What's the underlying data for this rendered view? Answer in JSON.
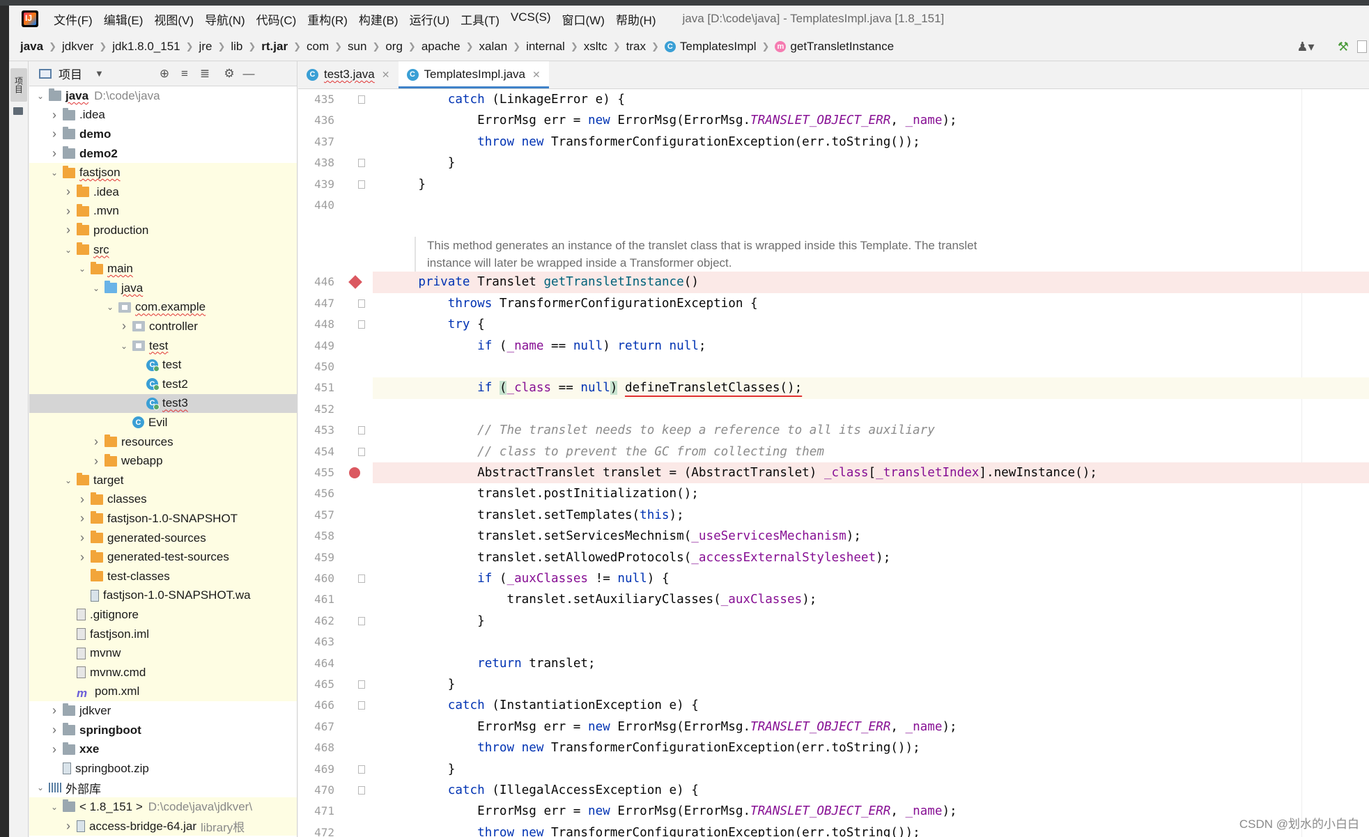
{
  "menu": {
    "items": [
      "文件(F)",
      "编辑(E)",
      "视图(V)",
      "导航(N)",
      "代码(C)",
      "重构(R)",
      "构建(B)",
      "运行(U)",
      "工具(T)",
      "VCS(S)",
      "窗口(W)",
      "帮助(H)"
    ],
    "window_title": "java [D:\\code\\java] - TemplatesImpl.java [1.8_151]"
  },
  "breadcrumbs": [
    {
      "label": "java",
      "bold": true
    },
    {
      "label": "jdkver"
    },
    {
      "label": "jdk1.8.0_151"
    },
    {
      "label": "jre"
    },
    {
      "label": "lib"
    },
    {
      "label": "rt.jar",
      "bold": true
    },
    {
      "label": "com"
    },
    {
      "label": "sun"
    },
    {
      "label": "org"
    },
    {
      "label": "apache"
    },
    {
      "label": "xalan"
    },
    {
      "label": "internal"
    },
    {
      "label": "xsltc"
    },
    {
      "label": "trax"
    },
    {
      "label": "TemplatesImpl",
      "icon": "class-icon"
    },
    {
      "label": "getTransletInstance",
      "icon": "method-icon",
      "last": true
    }
  ],
  "tool_stripe": {
    "project_label": "项目"
  },
  "project_panel": {
    "title": "项目",
    "tree": [
      {
        "depth": 0,
        "arrow": "down",
        "icon": "folder-gray",
        "label": "java",
        "bold": true,
        "wavy": true,
        "path": "D:\\code\\java"
      },
      {
        "depth": 1,
        "arrow": "right",
        "icon": "folder-gray",
        "label": ".idea"
      },
      {
        "depth": 1,
        "arrow": "right",
        "icon": "folder-gray",
        "label": "demo",
        "bold": true
      },
      {
        "depth": 1,
        "arrow": "right",
        "icon": "folder-gray",
        "label": "demo2",
        "bold": true
      },
      {
        "depth": 1,
        "arrow": "down",
        "icon": "folder-orange",
        "label": "fastjson",
        "wavy": true,
        "yellow": true
      },
      {
        "depth": 2,
        "arrow": "right",
        "icon": "folder-orange",
        "label": ".idea",
        "yellow": true
      },
      {
        "depth": 2,
        "arrow": "right",
        "icon": "folder-orange",
        "label": ".mvn",
        "yellow": true
      },
      {
        "depth": 2,
        "arrow": "right",
        "icon": "folder-orange",
        "label": "production",
        "yellow": true
      },
      {
        "depth": 2,
        "arrow": "down",
        "icon": "folder-orange",
        "label": "src",
        "wavy": true,
        "yellow": true
      },
      {
        "depth": 3,
        "arrow": "down",
        "icon": "folder-orange",
        "label": "main",
        "wavy": true,
        "yellow": true
      },
      {
        "depth": 4,
        "arrow": "down",
        "icon": "folder-blue",
        "label": "java",
        "wavy": true,
        "yellow": true
      },
      {
        "depth": 5,
        "arrow": "down",
        "icon": "folder-pkg",
        "label": "com.example",
        "wavy": true,
        "yellow": true
      },
      {
        "depth": 6,
        "arrow": "right",
        "icon": "folder-pkg",
        "label": "controller",
        "yellow": true
      },
      {
        "depth": 6,
        "arrow": "down",
        "icon": "folder-pkg",
        "label": "test",
        "wavy": true,
        "yellow": true
      },
      {
        "depth": 7,
        "arrow": "none",
        "icon": "class-test",
        "label": "test",
        "yellow": true
      },
      {
        "depth": 7,
        "arrow": "none",
        "icon": "class-test",
        "label": "test2",
        "yellow": true
      },
      {
        "depth": 7,
        "arrow": "none",
        "icon": "class-test",
        "label": "test3",
        "wavy": true,
        "selected": true
      },
      {
        "depth": 6,
        "arrow": "none",
        "icon": "class",
        "label": "Evil",
        "yellow": true
      },
      {
        "depth": 4,
        "arrow": "right",
        "icon": "folder-orange",
        "label": "resources",
        "yellow": true
      },
      {
        "depth": 4,
        "arrow": "right",
        "icon": "folder-orange",
        "label": "webapp",
        "yellow": true
      },
      {
        "depth": 2,
        "arrow": "down",
        "icon": "folder-orange",
        "label": "target",
        "yellow": true
      },
      {
        "depth": 3,
        "arrow": "right",
        "icon": "folder-orange",
        "label": "classes",
        "yellow": true
      },
      {
        "depth": 3,
        "arrow": "right",
        "icon": "folder-orange",
        "label": "fastjson-1.0-SNAPSHOT",
        "yellow": true
      },
      {
        "depth": 3,
        "arrow": "right",
        "icon": "folder-orange",
        "label": "generated-sources",
        "yellow": true
      },
      {
        "depth": 3,
        "arrow": "right",
        "icon": "folder-orange",
        "label": "generated-test-sources",
        "yellow": true
      },
      {
        "depth": 3,
        "arrow": "none",
        "icon": "folder-orange",
        "label": "test-classes",
        "yellow": true
      },
      {
        "depth": 3,
        "arrow": "none",
        "icon": "jar",
        "label": "fastjson-1.0-SNAPSHOT.wa",
        "yellow": true
      },
      {
        "depth": 2,
        "arrow": "none",
        "icon": "file",
        "label": ".gitignore",
        "yellow": true
      },
      {
        "depth": 2,
        "arrow": "none",
        "icon": "file",
        "label": "fastjson.iml",
        "yellow": true
      },
      {
        "depth": 2,
        "arrow": "none",
        "icon": "file",
        "label": "mvnw",
        "yellow": true
      },
      {
        "depth": 2,
        "arrow": "none",
        "icon": "file",
        "label": "mvnw.cmd",
        "yellow": true
      },
      {
        "depth": 2,
        "arrow": "none",
        "icon": "maven",
        "label": "pom.xml",
        "yellow": true
      },
      {
        "depth": 1,
        "arrow": "right",
        "icon": "folder-gray",
        "label": "jdkver"
      },
      {
        "depth": 1,
        "arrow": "right",
        "icon": "folder-gray",
        "label": "springboot",
        "bold": true
      },
      {
        "depth": 1,
        "arrow": "right",
        "icon": "folder-gray",
        "label": "xxe",
        "bold": true
      },
      {
        "depth": 1,
        "arrow": "none",
        "icon": "jar",
        "label": "springboot.zip"
      },
      {
        "depth": 0,
        "arrow": "down",
        "icon": "lib",
        "label": "外部库"
      },
      {
        "depth": 1,
        "arrow": "down",
        "icon": "folder-gray",
        "label": "< 1.8_151 >",
        "path": "D:\\code\\java\\jdkver\\",
        "yellow": true
      },
      {
        "depth": 2,
        "arrow": "right",
        "icon": "jar",
        "label": "access-bridge-64.jar",
        "suffix": "library根",
        "yellow": true
      }
    ]
  },
  "tabs": [
    {
      "label": "test3.java",
      "active": false,
      "wavy": true
    },
    {
      "label": "TemplatesImpl.java",
      "active": true
    }
  ],
  "javadoc": "This method generates an instance of the translet class that is wrapped inside this Template. The translet instance will later be wrapped inside a Transformer object.",
  "code_lines": [
    {
      "num": "435",
      "tokens": [
        [
          "        ",
          ""
        ],
        [
          "catch",
          "kw"
        ],
        [
          " (LinkageError e) {",
          ""
        ]
      ],
      "fold": true
    },
    {
      "num": "436",
      "tokens": [
        [
          "            ErrorMsg err = ",
          ""
        ],
        [
          "new",
          "kw"
        ],
        [
          " ErrorMsg(ErrorMsg.",
          ""
        ],
        [
          "TRANSLET_OBJECT_ERR",
          "cst"
        ],
        [
          ", ",
          ""
        ],
        [
          "_name",
          "fld"
        ],
        [
          ");",
          ""
        ]
      ]
    },
    {
      "num": "437",
      "tokens": [
        [
          "            ",
          ""
        ],
        [
          "throw",
          "kw"
        ],
        [
          " ",
          ""
        ],
        [
          "new",
          "kw"
        ],
        [
          " TransformerConfigurationException(err.toString());",
          ""
        ]
      ]
    },
    {
      "num": "438",
      "tokens": [
        [
          "        }",
          ""
        ]
      ],
      "fold": true
    },
    {
      "num": "439",
      "tokens": [
        [
          "    }",
          ""
        ]
      ],
      "fold": true
    },
    {
      "num": "440",
      "tokens": [
        [
          "",
          ""
        ]
      ]
    },
    {
      "num": "446",
      "tokens": [
        [
          "    ",
          ""
        ],
        [
          "private",
          "kw"
        ],
        [
          " Translet ",
          ""
        ],
        [
          "getTransletInstance",
          "mth"
        ],
        [
          "()",
          ""
        ]
      ],
      "marker": "diamond",
      "hl": "bp"
    },
    {
      "num": "447",
      "tokens": [
        [
          "        ",
          ""
        ],
        [
          "throws",
          "kw"
        ],
        [
          " TransformerConfigurationException {",
          ""
        ]
      ],
      "fold": true
    },
    {
      "num": "448",
      "tokens": [
        [
          "        ",
          ""
        ],
        [
          "try",
          "kw"
        ],
        [
          " {",
          ""
        ]
      ],
      "fold": true
    },
    {
      "num": "449",
      "tokens": [
        [
          "            ",
          ""
        ],
        [
          "if",
          "kw"
        ],
        [
          " (",
          ""
        ],
        [
          "_name",
          "fld"
        ],
        [
          " == ",
          ""
        ],
        [
          "null",
          "kw"
        ],
        [
          ") ",
          ""
        ],
        [
          "return",
          "kw"
        ],
        [
          " ",
          ""
        ],
        [
          "null",
          "kw"
        ],
        [
          ";",
          ""
        ]
      ]
    },
    {
      "num": "450",
      "tokens": [
        [
          "",
          ""
        ]
      ]
    },
    {
      "num": "451",
      "tokens": [
        [
          "            ",
          ""
        ],
        [
          "if",
          "kw"
        ],
        [
          " ",
          ""
        ],
        [
          "(",
          "brace"
        ],
        [
          "_class",
          "fld"
        ],
        [
          " == ",
          ""
        ],
        [
          "null",
          "kw"
        ],
        [
          ")",
          "brace"
        ],
        [
          " ",
          ""
        ],
        [
          "defineTransletClasses();",
          "err"
        ]
      ],
      "hl": "caret"
    },
    {
      "num": "452",
      "tokens": [
        [
          "",
          ""
        ]
      ]
    },
    {
      "num": "453",
      "tokens": [
        [
          "            ",
          ""
        ],
        [
          "// The translet needs to keep a reference to all its auxiliary",
          "cm"
        ]
      ],
      "fold": true
    },
    {
      "num": "454",
      "tokens": [
        [
          "            ",
          ""
        ],
        [
          "// class to prevent the GC from collecting them",
          "cm"
        ]
      ],
      "fold": true
    },
    {
      "num": "455",
      "tokens": [
        [
          "            AbstractTranslet translet = (AbstractTranslet) ",
          ""
        ],
        [
          "_class",
          "fld"
        ],
        [
          "[",
          ""
        ],
        [
          "_transletIndex",
          "fld"
        ],
        [
          "].newInstance();",
          ""
        ]
      ],
      "marker": "dot",
      "hl": "bp"
    },
    {
      "num": "456",
      "tokens": [
        [
          "            translet.postInitialization();",
          ""
        ]
      ]
    },
    {
      "num": "457",
      "tokens": [
        [
          "            translet.setTemplates(",
          ""
        ],
        [
          "this",
          "kw"
        ],
        [
          ");",
          ""
        ]
      ]
    },
    {
      "num": "458",
      "tokens": [
        [
          "            translet.setServicesMechnism(",
          ""
        ],
        [
          "_useServicesMechanism",
          "fld"
        ],
        [
          ");",
          ""
        ]
      ]
    },
    {
      "num": "459",
      "tokens": [
        [
          "            translet.setAllowedProtocols(",
          ""
        ],
        [
          "_accessExternalStylesheet",
          "fld"
        ],
        [
          ");",
          ""
        ]
      ]
    },
    {
      "num": "460",
      "tokens": [
        [
          "            ",
          ""
        ],
        [
          "if",
          "kw"
        ],
        [
          " (",
          ""
        ],
        [
          "_auxClasses",
          "fld"
        ],
        [
          " != ",
          ""
        ],
        [
          "null",
          "kw"
        ],
        [
          ") {",
          ""
        ]
      ],
      "fold": true
    },
    {
      "num": "461",
      "tokens": [
        [
          "                translet.setAuxiliaryClasses(",
          ""
        ],
        [
          "_auxClasses",
          "fld"
        ],
        [
          ");",
          ""
        ]
      ]
    },
    {
      "num": "462",
      "tokens": [
        [
          "            }",
          ""
        ]
      ],
      "fold": true
    },
    {
      "num": "463",
      "tokens": [
        [
          "",
          ""
        ]
      ]
    },
    {
      "num": "464",
      "tokens": [
        [
          "            ",
          ""
        ],
        [
          "return",
          "kw"
        ],
        [
          " translet;",
          ""
        ]
      ]
    },
    {
      "num": "465",
      "tokens": [
        [
          "        }",
          ""
        ]
      ],
      "fold": true
    },
    {
      "num": "466",
      "tokens": [
        [
          "        ",
          ""
        ],
        [
          "catch",
          "kw"
        ],
        [
          " (InstantiationException e) {",
          ""
        ]
      ],
      "fold": true
    },
    {
      "num": "467",
      "tokens": [
        [
          "            ErrorMsg err = ",
          ""
        ],
        [
          "new",
          "kw"
        ],
        [
          " ErrorMsg(ErrorMsg.",
          ""
        ],
        [
          "TRANSLET_OBJECT_ERR",
          "cst"
        ],
        [
          ", ",
          ""
        ],
        [
          "_name",
          "fld"
        ],
        [
          ");",
          ""
        ]
      ]
    },
    {
      "num": "468",
      "tokens": [
        [
          "            ",
          ""
        ],
        [
          "throw",
          "kw"
        ],
        [
          " ",
          ""
        ],
        [
          "new",
          "kw"
        ],
        [
          " TransformerConfigurationException(err.toString());",
          ""
        ]
      ]
    },
    {
      "num": "469",
      "tokens": [
        [
          "        }",
          ""
        ]
      ],
      "fold": true
    },
    {
      "num": "470",
      "tokens": [
        [
          "        ",
          ""
        ],
        [
          "catch",
          "kw"
        ],
        [
          " (IllegalAccessException e) {",
          ""
        ]
      ],
      "fold": true
    },
    {
      "num": "471",
      "tokens": [
        [
          "            ErrorMsg err = ",
          ""
        ],
        [
          "new",
          "kw"
        ],
        [
          " ErrorMsg(ErrorMsg.",
          ""
        ],
        [
          "TRANSLET_OBJECT_ERR",
          "cst"
        ],
        [
          ", ",
          ""
        ],
        [
          "_name",
          "fld"
        ],
        [
          ");",
          ""
        ]
      ]
    },
    {
      "num": "472",
      "tokens": [
        [
          "            ",
          ""
        ],
        [
          "throw",
          "kw"
        ],
        [
          " ",
          ""
        ],
        [
          "new",
          "kw"
        ],
        [
          " TransformerConfigurationException(err.toString());",
          ""
        ]
      ]
    }
  ],
  "watermark": "CSDN @划水的小白白",
  "colors": {
    "keyword": "#0033b3",
    "field": "#871094",
    "comment": "#8c8c8c",
    "method": "#00627a",
    "breakpoint": "#db5860",
    "active_tab": "#4083c9"
  }
}
